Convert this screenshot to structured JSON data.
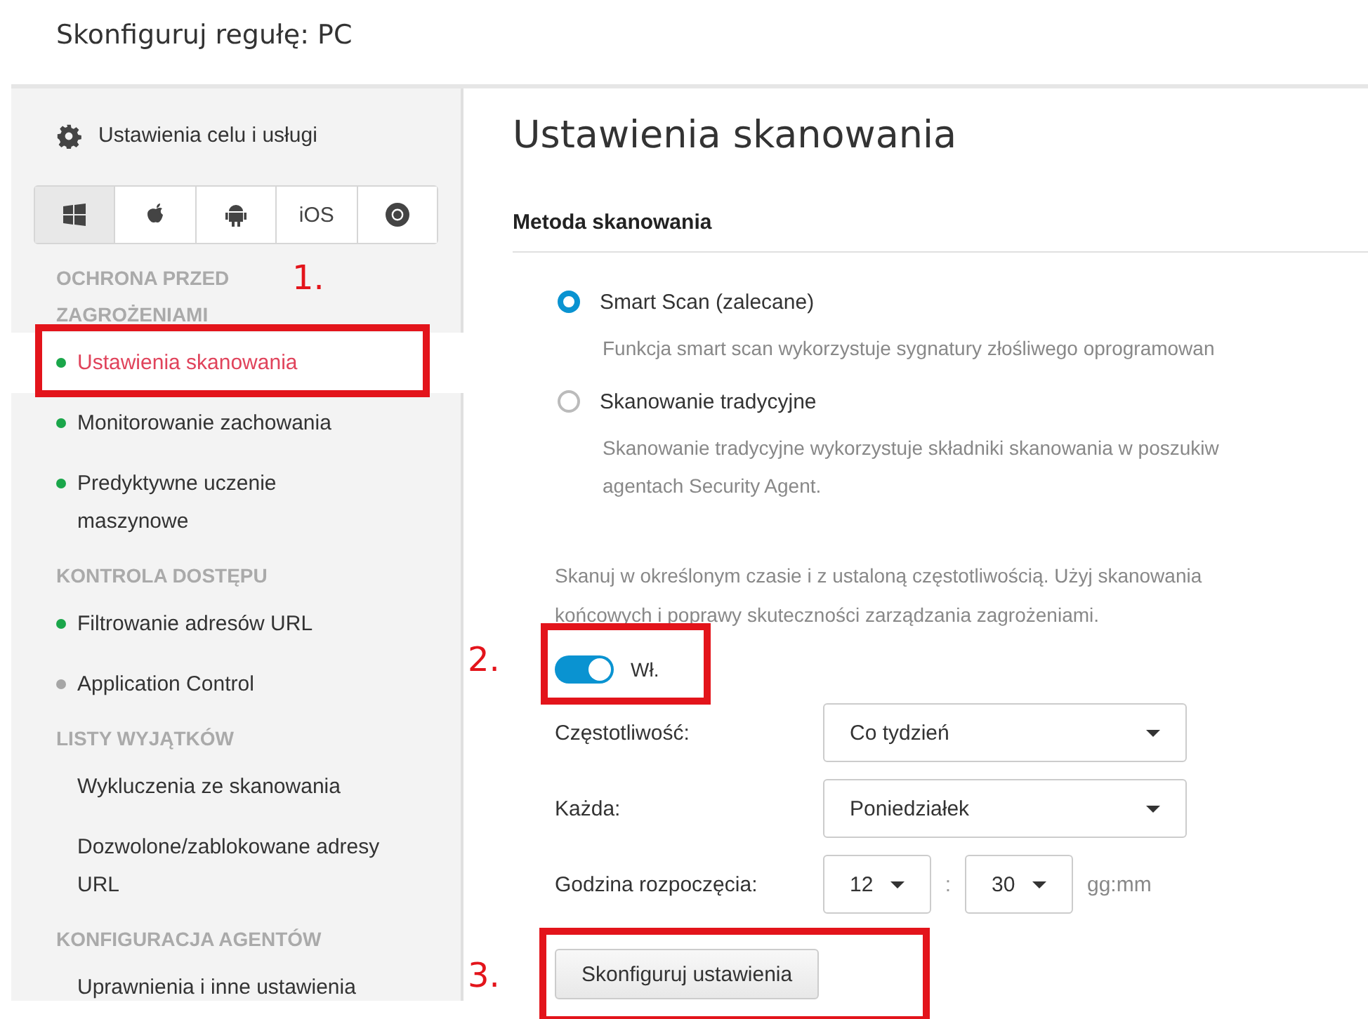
{
  "window": {
    "title": "Skonfiguruj regułę: PC"
  },
  "sidebar": {
    "header": "Ustawienia celu i usługi",
    "platforms": [
      {
        "kind": "windows",
        "selected": true
      },
      {
        "kind": "apple",
        "selected": false
      },
      {
        "kind": "android",
        "selected": false
      },
      {
        "kind": "text",
        "label": "iOS",
        "selected": false
      },
      {
        "kind": "chrome",
        "selected": false
      }
    ],
    "sections": [
      {
        "title": "OCHRONA PRZED ZAGROŻENIAMI",
        "items": [
          {
            "label": "Ustawienia skanowania",
            "color": "#1aa64a",
            "selected": true
          },
          {
            "label": "Monitorowanie zachowania",
            "color": "#1aa64a",
            "selected": false
          },
          {
            "label": "Predyktywne uczenie maszynowe",
            "color": "#1aa64a",
            "selected": false
          }
        ]
      },
      {
        "title": "KONTROLA DOSTĘPU",
        "items": [
          {
            "label": "Filtrowanie adresów URL",
            "color": "#1aa64a",
            "selected": false
          },
          {
            "label": "Application Control",
            "color": "#a6a6a6",
            "selected": false
          }
        ]
      },
      {
        "title": "LISTY WYJĄTKÓW",
        "items": [
          {
            "label": "Wykluczenia ze skanowania",
            "selected": false
          },
          {
            "label": "Dozwolone/zablokowane adresy URL",
            "selected": false
          }
        ]
      },
      {
        "title": "KONFIGURACJA AGENTÓW",
        "items": [
          {
            "label": "Uprawnienia i inne ustawienia",
            "selected": false
          }
        ]
      }
    ]
  },
  "main": {
    "title": "Ustawienia skanowania",
    "section": "Metoda skanowania",
    "methods": [
      {
        "label": "Smart Scan (zalecane)",
        "description": "Funkcja smart scan wykorzystuje sygnatury złośliwego oprogramowan",
        "selected": true
      },
      {
        "label": "Skanowanie tradycyjne",
        "description": "Skanowanie tradycyjne wykorzystuje składniki skanowania w poszukiw\nagentach Security Agent.",
        "selected": false
      }
    ],
    "schedule_text": "Skanuj w określonym czasie i z ustaloną częstotliwością. Użyj skanowania\nkońcowych i poprawy skuteczności zarządzania zagrożeniami.",
    "toggle": {
      "on": true,
      "label": "Wł."
    },
    "frequency": {
      "label": "Częstotliwość:",
      "value": "Co tydzień"
    },
    "day": {
      "label": "Każda:",
      "value": "Poniedziałek"
    },
    "start_time": {
      "label": "Godzina rozpoczęcia:",
      "hour": "12",
      "separator": ":",
      "minute": "30",
      "format": "gg:mm"
    },
    "button": "Skonfiguruj ustawienia"
  },
  "annotations": [
    "1.",
    "2.",
    "3."
  ]
}
